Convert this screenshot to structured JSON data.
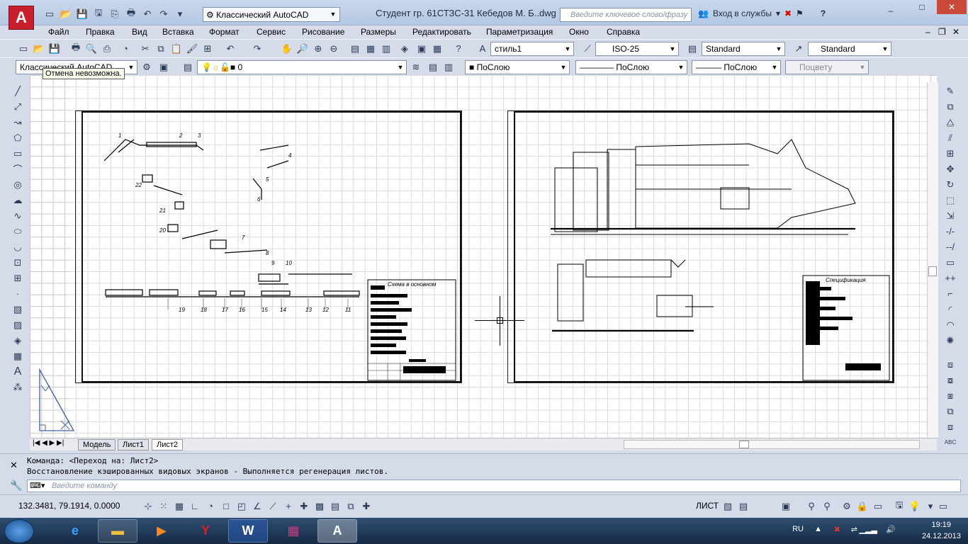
{
  "window": {
    "title": "Студент гр. 61СТЗС-31 Кебедов М. Б..dwg",
    "workspace": "Классический AutoCAD",
    "search_placeholder": "Введите ключевое слово/фразу",
    "login": "Вход в службы",
    "help": "?",
    "min": "_",
    "max": "□",
    "close": "✕",
    "doc_min": "–",
    "doc_restore": "❐",
    "doc_close": "✕"
  },
  "logo": "A",
  "menu": [
    "Файл",
    "Правка",
    "Вид",
    "Вставка",
    "Формат",
    "Сервис",
    "Рисование",
    "Размеры",
    "Редактировать",
    "Параметризация",
    "Окно",
    "Справка"
  ],
  "toolbar2": {
    "text_style": "стиль1",
    "dim_style": "ISO-25",
    "table_style": "Standard",
    "mleader_style": "Standard"
  },
  "toolbar3": {
    "workspace": "Классический AutoCAD",
    "layer": "0",
    "color": "ПоСлою",
    "linetype": "ПоСлою",
    "lineweight": "ПоСлою",
    "plotstyle": "Поцвету"
  },
  "tooltip": "Отмена невозможна.",
  "tabs": [
    "Модель",
    "Лист1",
    "Лист2"
  ],
  "active_tab": "Лист2",
  "command": {
    "line1": "Команда:   <Переход на: Лист2>",
    "line2": "Восстановление кэшированных видовых экранов - Выполняется регенерация листов.",
    "placeholder": "Введите команду"
  },
  "status": {
    "coords": "132.3481, 79.1914, 0.0000",
    "space": "ЛИСТ"
  },
  "drawing_labels": {
    "left": [
      "1",
      "2",
      "3",
      "4",
      "5",
      "6",
      "7",
      "8",
      "9",
      "10",
      "11",
      "12",
      "13",
      "14",
      "15",
      "16",
      "17",
      "18",
      "19",
      "20",
      "21",
      "22"
    ],
    "left_title": "Схема в основном",
    "right_title": "Спецификация"
  },
  "tray": {
    "lang": "RU",
    "time": "19:19",
    "date": "24.12.2013"
  },
  "taskbar_apps": [
    "ie",
    "explorer",
    "media",
    "yandex",
    "word",
    "winrar",
    "autocad"
  ]
}
